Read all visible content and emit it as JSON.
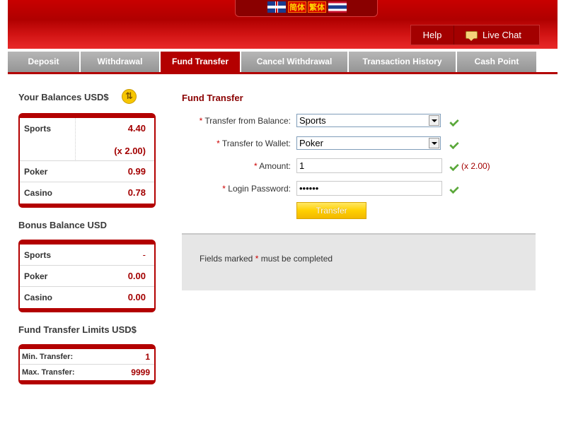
{
  "header": {
    "languages": [
      {
        "name": "uk-flag-icon"
      },
      {
        "label": "简体"
      },
      {
        "label": "繁体"
      },
      {
        "name": "thai-flag-icon"
      }
    ],
    "help_label": "Help",
    "livechat_label": "Live Chat",
    "colors": {
      "brand": "#b30000",
      "accent": "#ffd000"
    }
  },
  "tabs": [
    {
      "label": "Deposit",
      "active": false
    },
    {
      "label": "Withdrawal",
      "active": false
    },
    {
      "label": "Fund Transfer",
      "active": true
    },
    {
      "label": "Cancel Withdrawal",
      "active": false
    },
    {
      "label": "Transaction History",
      "active": false
    },
    {
      "label": "Cash Point",
      "active": false
    }
  ],
  "balances": {
    "title": "Your Balances USD$",
    "rows": [
      {
        "label": "Sports",
        "value": "4.40",
        "multiplier": "(x 2.00)"
      },
      {
        "label": "Poker",
        "value": "0.99"
      },
      {
        "label": "Casino",
        "value": "0.78"
      }
    ]
  },
  "bonus": {
    "title": "Bonus Balance USD",
    "rows": [
      {
        "label": "Sports",
        "value": "-"
      },
      {
        "label": "Poker",
        "value": "0.00"
      },
      {
        "label": "Casino",
        "value": "0.00"
      }
    ]
  },
  "limits": {
    "title": "Fund Transfer Limits USD$",
    "rows": [
      {
        "label": "Min. Transfer:",
        "value": "1"
      },
      {
        "label": "Max. Transfer:",
        "value": "9999"
      }
    ]
  },
  "form": {
    "title": "Fund Transfer",
    "required_mark": "*",
    "from_label": "Transfer from Balance:",
    "from_value": "Sports",
    "to_label": "Transfer to Wallet:",
    "to_value": "Poker",
    "amount_label": "Amount:",
    "amount_value": "1",
    "amount_multiplier": "(x 2.00)",
    "password_label": "Login Password:",
    "password_value": "••••••",
    "submit_label": "Transfer",
    "note_prefix": "Fields marked ",
    "note_suffix": " must be completed"
  }
}
